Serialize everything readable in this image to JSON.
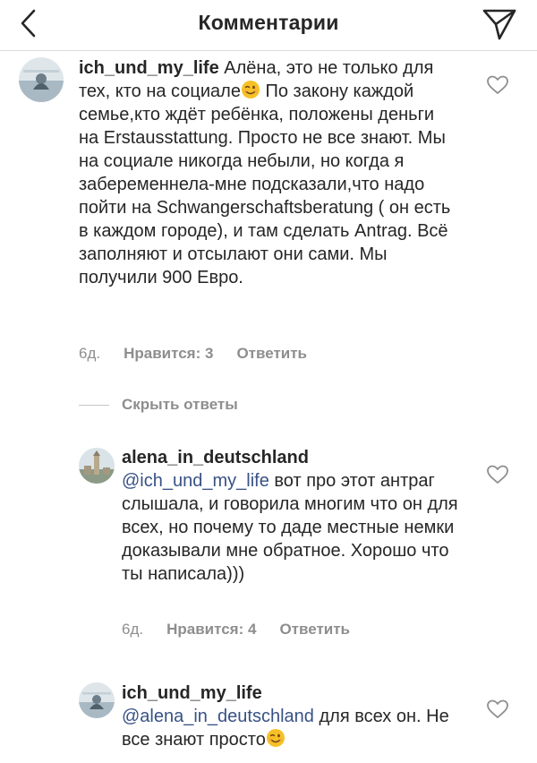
{
  "header": {
    "title": "Комментарии",
    "back_icon": "chevron-left-icon",
    "send_icon": "paper-plane-icon"
  },
  "comments": [
    {
      "username": "ich_und_my_life",
      "text_before_emoji": " Алёна, это не только для тех, кто на социале",
      "emoji": "winking-face",
      "text_after_emoji": " По закону каждой семье,кто ждёт ребёнка, положены деньги на Erstausstattung. Просто не все знают. Мы на социале никогда небыли, но когда я забеременнела-мне подсказали,что надо пойти на Schwangerschaftsberatung ( он есть в каждом городе), и там сделать Antrag. Всё заполняют и отсылают они сами. Мы получили 900 Евро.",
      "time": "6д.",
      "likes": "Нравится: 3",
      "reply": "Ответить"
    }
  ],
  "replies_toggle": "Скрыть ответы",
  "replies": [
    {
      "username": "alena_in_deutschland",
      "mention": "@ich_und_my_life",
      "text": " вот про этот антраг слышала, и говорила многим что он для всех, но почему то даде местные немки доказывали мне обратное. Хорошо что ты написала)))",
      "time": "6д.",
      "likes": "Нравится: 4",
      "reply": "Ответить"
    },
    {
      "username": "ich_und_my_life",
      "mention": "@alena_in_deutschland",
      "text": " для всех он. Не все знают просто",
      "emoji": "winking-face"
    }
  ],
  "colors": {
    "text": "#262626",
    "secondary": "#8e8e8e",
    "mention": "#385185",
    "divider": "#dbdbdb"
  }
}
